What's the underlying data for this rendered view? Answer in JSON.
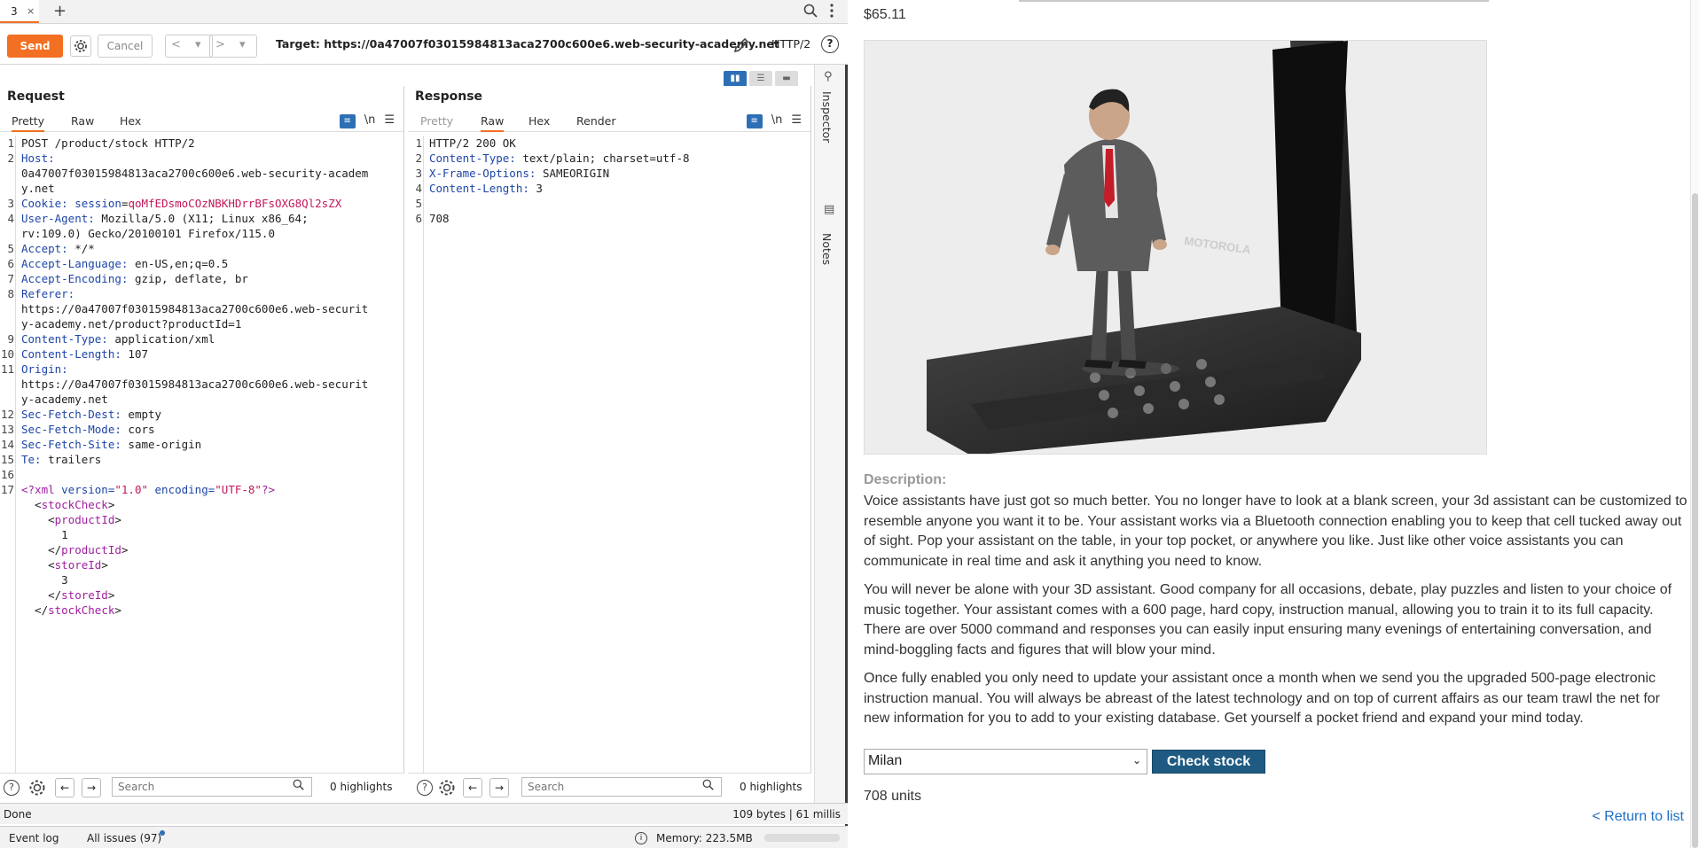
{
  "tabs": {
    "active_label": "3",
    "close_glyph": "×",
    "add_glyph": "+"
  },
  "toolbar": {
    "send_label": "Send",
    "cancel_label": "Cancel",
    "back_glyph": "< ▾",
    "fwd_glyph": "> ▾",
    "target_label": "Target: https://0a47007f03015984813aca2700c600e6.web-security-academy.net",
    "protocol_label": "HTTP/2",
    "help_glyph": "?"
  },
  "request": {
    "title": "Request",
    "tabs": [
      "Pretty",
      "Raw",
      "Hex"
    ],
    "active_tab": "Pretty",
    "lines": [
      {
        "n": "1",
        "segments": [
          {
            "t": "POST /product/stock HTTP/2",
            "c": "hv"
          }
        ]
      },
      {
        "n": "2",
        "segments": [
          {
            "t": "Host:",
            "c": "hk"
          }
        ]
      },
      {
        "n": "",
        "segments": [
          {
            "t": "0a47007f03015984813aca2700c600e6.web-security-academ",
            "c": "hv"
          }
        ]
      },
      {
        "n": "",
        "segments": [
          {
            "t": "y.net",
            "c": "hv"
          }
        ]
      },
      {
        "n": "3",
        "segments": [
          {
            "t": "Cookie: ",
            "c": "hk"
          },
          {
            "t": "session",
            "c": "hk"
          },
          {
            "t": "=",
            "c": "hv"
          },
          {
            "t": "qoMfEDsmoCOzNBKHDrrBFsOXG8Ql2sZX",
            "c": "cv"
          }
        ]
      },
      {
        "n": "4",
        "segments": [
          {
            "t": "User-Agent: ",
            "c": "hk"
          },
          {
            "t": "Mozilla/5.0 (X11; Linux x86_64;",
            "c": "hv"
          }
        ]
      },
      {
        "n": "",
        "segments": [
          {
            "t": "rv:109.0) Gecko/20100101 Firefox/115.0",
            "c": "hv"
          }
        ]
      },
      {
        "n": "5",
        "segments": [
          {
            "t": "Accept: ",
            "c": "hk"
          },
          {
            "t": "*/*",
            "c": "hv"
          }
        ]
      },
      {
        "n": "6",
        "segments": [
          {
            "t": "Accept-Language: ",
            "c": "hk"
          },
          {
            "t": "en-US,en;q=0.5",
            "c": "hv"
          }
        ]
      },
      {
        "n": "7",
        "segments": [
          {
            "t": "Accept-Encoding: ",
            "c": "hk"
          },
          {
            "t": "gzip, deflate, br",
            "c": "hv"
          }
        ]
      },
      {
        "n": "8",
        "segments": [
          {
            "t": "Referer:",
            "c": "hk"
          }
        ]
      },
      {
        "n": "",
        "segments": [
          {
            "t": "https://0a47007f03015984813aca2700c600e6.web-securit",
            "c": "hv"
          }
        ]
      },
      {
        "n": "",
        "segments": [
          {
            "t": "y-academy.net/product?productId=1",
            "c": "hv"
          }
        ]
      },
      {
        "n": "9",
        "segments": [
          {
            "t": "Content-Type: ",
            "c": "hk"
          },
          {
            "t": "application/xml",
            "c": "hv"
          }
        ]
      },
      {
        "n": "10",
        "segments": [
          {
            "t": "Content-Length: ",
            "c": "hk"
          },
          {
            "t": "107",
            "c": "hv"
          }
        ]
      },
      {
        "n": "11",
        "segments": [
          {
            "t": "Origin:",
            "c": "hk"
          }
        ]
      },
      {
        "n": "",
        "hl": true,
        "segments": [
          {
            "t": "https://0a47007f03015984813aca2700c600e6.web-securit",
            "c": "hv"
          }
        ]
      },
      {
        "n": "",
        "segments": [
          {
            "t": "y-academy.net",
            "c": "hv"
          }
        ]
      },
      {
        "n": "12",
        "segments": [
          {
            "t": "Sec-Fetch-Dest: ",
            "c": "hk"
          },
          {
            "t": "empty",
            "c": "hv"
          }
        ]
      },
      {
        "n": "13",
        "segments": [
          {
            "t": "Sec-Fetch-Mode: ",
            "c": "hk"
          },
          {
            "t": "cors",
            "c": "hv"
          }
        ]
      },
      {
        "n": "14",
        "segments": [
          {
            "t": "Sec-Fetch-Site: ",
            "c": "hk"
          },
          {
            "t": "same-origin",
            "c": "hv"
          }
        ]
      },
      {
        "n": "15",
        "segments": [
          {
            "t": "Te: ",
            "c": "hk"
          },
          {
            "t": "trailers",
            "c": "hv"
          }
        ]
      },
      {
        "n": "16",
        "segments": [
          {
            "t": "",
            "c": "hv"
          }
        ]
      },
      {
        "n": "17",
        "segments": [
          {
            "t": "<?xml ",
            "c": "tag"
          },
          {
            "t": "version=",
            "c": "attr"
          },
          {
            "t": "\"1.0\" ",
            "c": "str"
          },
          {
            "t": "encoding=",
            "c": "attr"
          },
          {
            "t": "\"UTF-8\"",
            "c": "str"
          },
          {
            "t": "?>",
            "c": "tag"
          }
        ]
      },
      {
        "n": "",
        "segments": [
          {
            "t": "  <",
            "c": "hv"
          },
          {
            "t": "stockCheck",
            "c": "tag"
          },
          {
            "t": ">",
            "c": "hv"
          }
        ]
      },
      {
        "n": "",
        "segments": [
          {
            "t": "    <",
            "c": "hv"
          },
          {
            "t": "productId",
            "c": "tag"
          },
          {
            "t": ">",
            "c": "hv"
          }
        ]
      },
      {
        "n": "",
        "segments": [
          {
            "t": "      1",
            "c": "hv"
          }
        ]
      },
      {
        "n": "",
        "segments": [
          {
            "t": "    </",
            "c": "hv"
          },
          {
            "t": "productId",
            "c": "tag"
          },
          {
            "t": ">",
            "c": "hv"
          }
        ]
      },
      {
        "n": "",
        "segments": [
          {
            "t": "    <",
            "c": "hv"
          },
          {
            "t": "storeId",
            "c": "tag"
          },
          {
            "t": ">",
            "c": "hv"
          }
        ]
      },
      {
        "n": "",
        "segments": [
          {
            "t": "      3",
            "c": "hv"
          }
        ]
      },
      {
        "n": "",
        "segments": [
          {
            "t": "    </",
            "c": "hv"
          },
          {
            "t": "storeId",
            "c": "tag"
          },
          {
            "t": ">",
            "c": "hv"
          }
        ]
      },
      {
        "n": "",
        "segments": [
          {
            "t": "  </",
            "c": "hv"
          },
          {
            "t": "stockCheck",
            "c": "tag"
          },
          {
            "t": ">",
            "c": "hv"
          }
        ]
      }
    ],
    "search_placeholder": "Search",
    "highlights": "0 highlights"
  },
  "response": {
    "title": "Response",
    "tabs": [
      "Pretty",
      "Raw",
      "Hex",
      "Render"
    ],
    "active_tab": "Raw",
    "lines": [
      {
        "n": "1",
        "hl": true,
        "segments": [
          {
            "t": "HTTP/2 200 OK",
            "c": "hv"
          }
        ]
      },
      {
        "n": "2",
        "segments": [
          {
            "t": "Content-Type: ",
            "c": "hk"
          },
          {
            "t": "text/plain; charset=utf-8",
            "c": "hv"
          }
        ]
      },
      {
        "n": "3",
        "segments": [
          {
            "t": "X-Frame-Options: ",
            "c": "hk"
          },
          {
            "t": "SAMEORIGIN",
            "c": "hv"
          }
        ]
      },
      {
        "n": "4",
        "segments": [
          {
            "t": "Content-Length: ",
            "c": "hk"
          },
          {
            "t": "3",
            "c": "hv"
          }
        ]
      },
      {
        "n": "5",
        "segments": [
          {
            "t": "",
            "c": "hv"
          }
        ]
      },
      {
        "n": "6",
        "segments": [
          {
            "t": "708",
            "c": "hv"
          }
        ]
      }
    ],
    "search_placeholder": "Search",
    "highlights": "0 highlights"
  },
  "rail": {
    "inspector": "Inspector",
    "notes": "Notes"
  },
  "status": {
    "left": "Done",
    "right": "109 bytes | 61 millis"
  },
  "footer": {
    "event_log": "Event log",
    "issues": "All issues (97)",
    "memory": "Memory: 223.5MB"
  },
  "web": {
    "price": "$65.11",
    "description_label": "Description:",
    "paragraphs": [
      "Voice assistants have just got so much better. You no longer have to look at a blank screen, your 3d assistant can be customized to resemble anyone you want it to be. Your assistant works via a Bluetooth connection enabling you to keep that cell tucked away out of sight. Pop your assistant on the table, in your top pocket, or anywhere you like. Just like other voice assistants you can communicate in real time and ask it anything you need to know.",
      "You will never be alone with your 3D assistant. Good company for all occasions, debate, play puzzles and listen to your choice of music together. Your assistant comes with a 600 page, hard copy, instruction manual, allowing you to train it to its full capacity. There are over 5000 command and responses you can easily input ensuring many evenings of entertaining conversation, and mind-boggling facts and figures that will blow your mind.",
      "Once fully enabled you only need to update your assistant once a month when we send you the upgraded 500-page electronic instruction manual. You will always be abreast of the latest technology and on top of current affairs as our team trawl the net for new information for you to add to your existing database. Get yourself a pocket friend and expand your mind today."
    ],
    "store_selected": "Milan",
    "check_label": "Check stock",
    "units": "708 units",
    "return_label": "< Return to list",
    "phone_brand": "MOTOROLA"
  }
}
